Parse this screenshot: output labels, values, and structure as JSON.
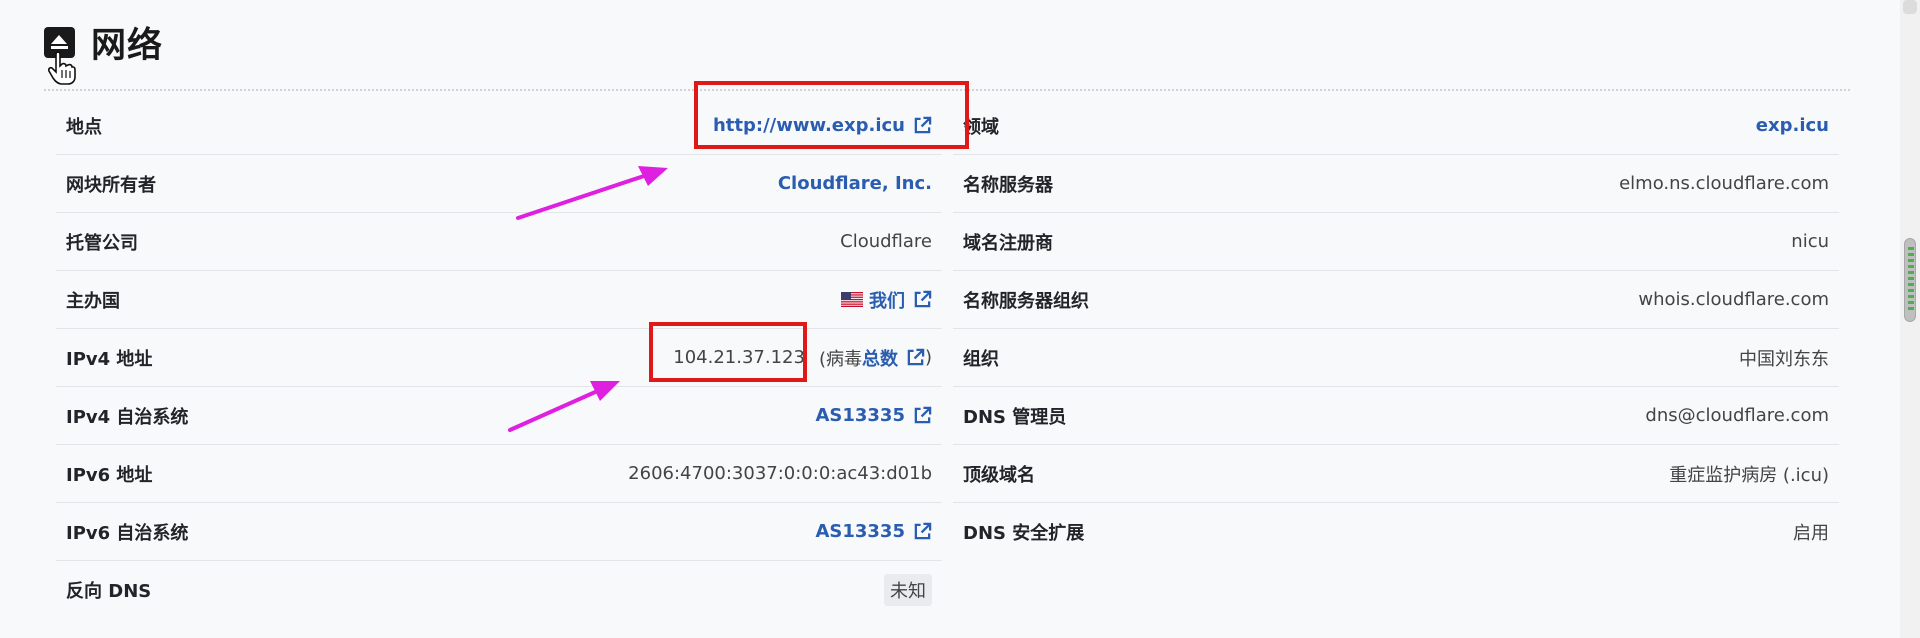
{
  "header": {
    "title": "网络"
  },
  "left_rows": [
    {
      "label": "地点",
      "value": "http://www.exp.icu"
    },
    {
      "label": "网块所有者",
      "value": "Cloudflare, Inc."
    },
    {
      "label": "托管公司",
      "value": "Cloudflare"
    },
    {
      "label": "主办国",
      "value": "我们"
    },
    {
      "label": "IPv4 地址",
      "value": "104.21.37.123",
      "paren_open": "(病毒",
      "link": "总数",
      "paren_close": ")"
    },
    {
      "label": "IPv4 自治系统",
      "value": "AS13335"
    },
    {
      "label": "IPv6 地址",
      "value": "2606:4700:3037:0:0:0:ac43:d01b"
    },
    {
      "label": "IPv6 自治系统",
      "value": "AS13335"
    },
    {
      "label": "反向 DNS",
      "value": "未知"
    }
  ],
  "right_rows": [
    {
      "label": "领域",
      "value": "exp.icu"
    },
    {
      "label": "名称服务器",
      "value": "elmo.ns.cloudflare.com"
    },
    {
      "label": "域名注册商",
      "value": "nicu"
    },
    {
      "label": "名称服务器组织",
      "value": "whois.cloudflare.com"
    },
    {
      "label": "组织",
      "value": "中国刘东东"
    },
    {
      "label": "DNS 管理员",
      "value": "dns@cloudflare.com"
    },
    {
      "label": "顶级域名",
      "value": "重症监护病房 (.icu)"
    },
    {
      "label": "DNS 安全扩展",
      "value": "启用"
    }
  ],
  "colors": {
    "link": "#2a5db0",
    "annotation_box": "#e01818",
    "annotation_arrow": "#e020e0"
  },
  "icons": [
    "collapse-up-icon",
    "hand-cursor-icon",
    "external-link-icon",
    "us-flag-icon"
  ]
}
